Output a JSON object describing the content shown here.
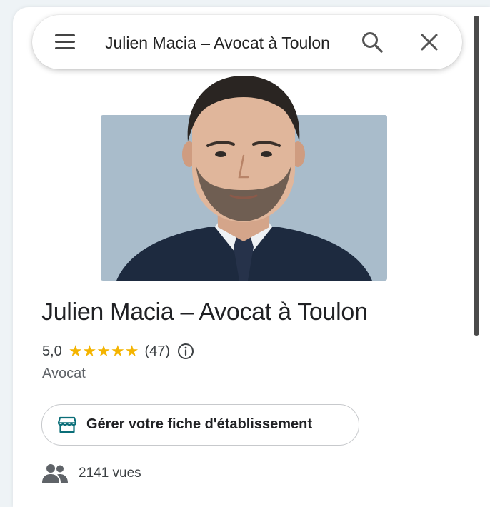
{
  "search": {
    "query": "Julien Macia – Avocat à Toulon"
  },
  "place": {
    "name": "Julien Macia – Avocat à Toulon",
    "rating": "5,0",
    "stars": 5,
    "reviews": "(47)",
    "category": "Avocat"
  },
  "actions": {
    "manage_label": "Gérer votre fiche d'établissement"
  },
  "stats": {
    "views": "2141 vues"
  },
  "icons": {
    "menu": "hamburger-menu-icon",
    "search": "search-icon",
    "close": "close-icon",
    "info": "info-icon",
    "store": "storefront-icon",
    "people": "people-icon"
  },
  "colors": {
    "star": "#f4b400",
    "teal_icon": "#0b6e78",
    "photo_background": "#a9bccb"
  }
}
